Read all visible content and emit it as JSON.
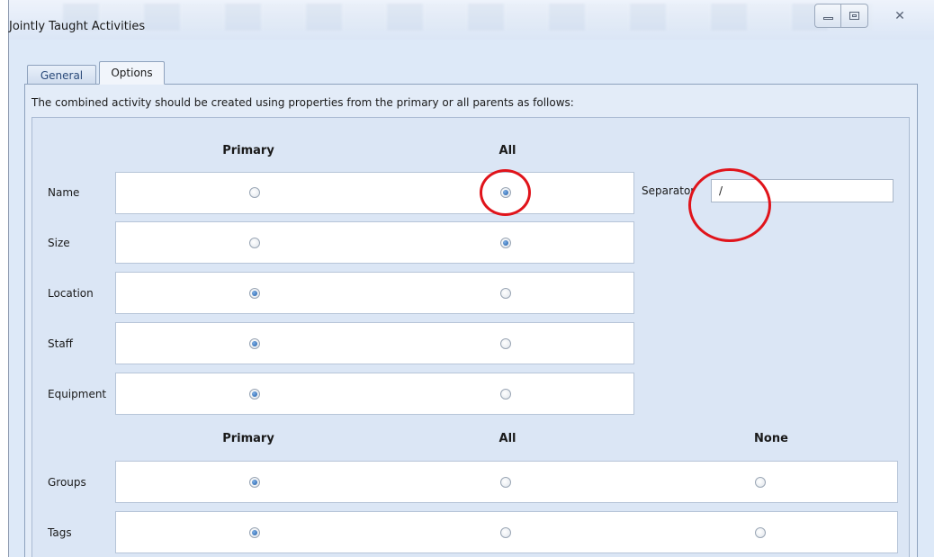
{
  "window": {
    "title": "Jointly Taught Activities",
    "controls": {
      "minimize": "minimize",
      "maximize": "maximize",
      "close": "✕"
    }
  },
  "tabs": [
    {
      "label": "General",
      "active": false
    },
    {
      "label": "Options",
      "active": true
    }
  ],
  "options": {
    "description": "The combined activity should be created using properties from the primary or all parents as follows:",
    "header_top": {
      "primary": "Primary",
      "all": "All"
    },
    "rows_top": [
      {
        "label": "Name",
        "selected": "all"
      },
      {
        "label": "Size",
        "selected": "all"
      },
      {
        "label": "Location",
        "selected": "primary"
      },
      {
        "label": "Staff",
        "selected": "primary"
      },
      {
        "label": "Equipment",
        "selected": "primary"
      }
    ],
    "separator": {
      "label": "Separator",
      "value": "/"
    },
    "header_bottom": {
      "primary": "Primary",
      "all": "All",
      "none": "None"
    },
    "rows_bottom": [
      {
        "label": "Groups",
        "selected": "primary"
      },
      {
        "label": "Tags",
        "selected": "primary"
      }
    ]
  },
  "colors": {
    "annotation": "#e0141b",
    "window_bg": "#dde9f8",
    "radio_selected": "#1f5da8"
  }
}
